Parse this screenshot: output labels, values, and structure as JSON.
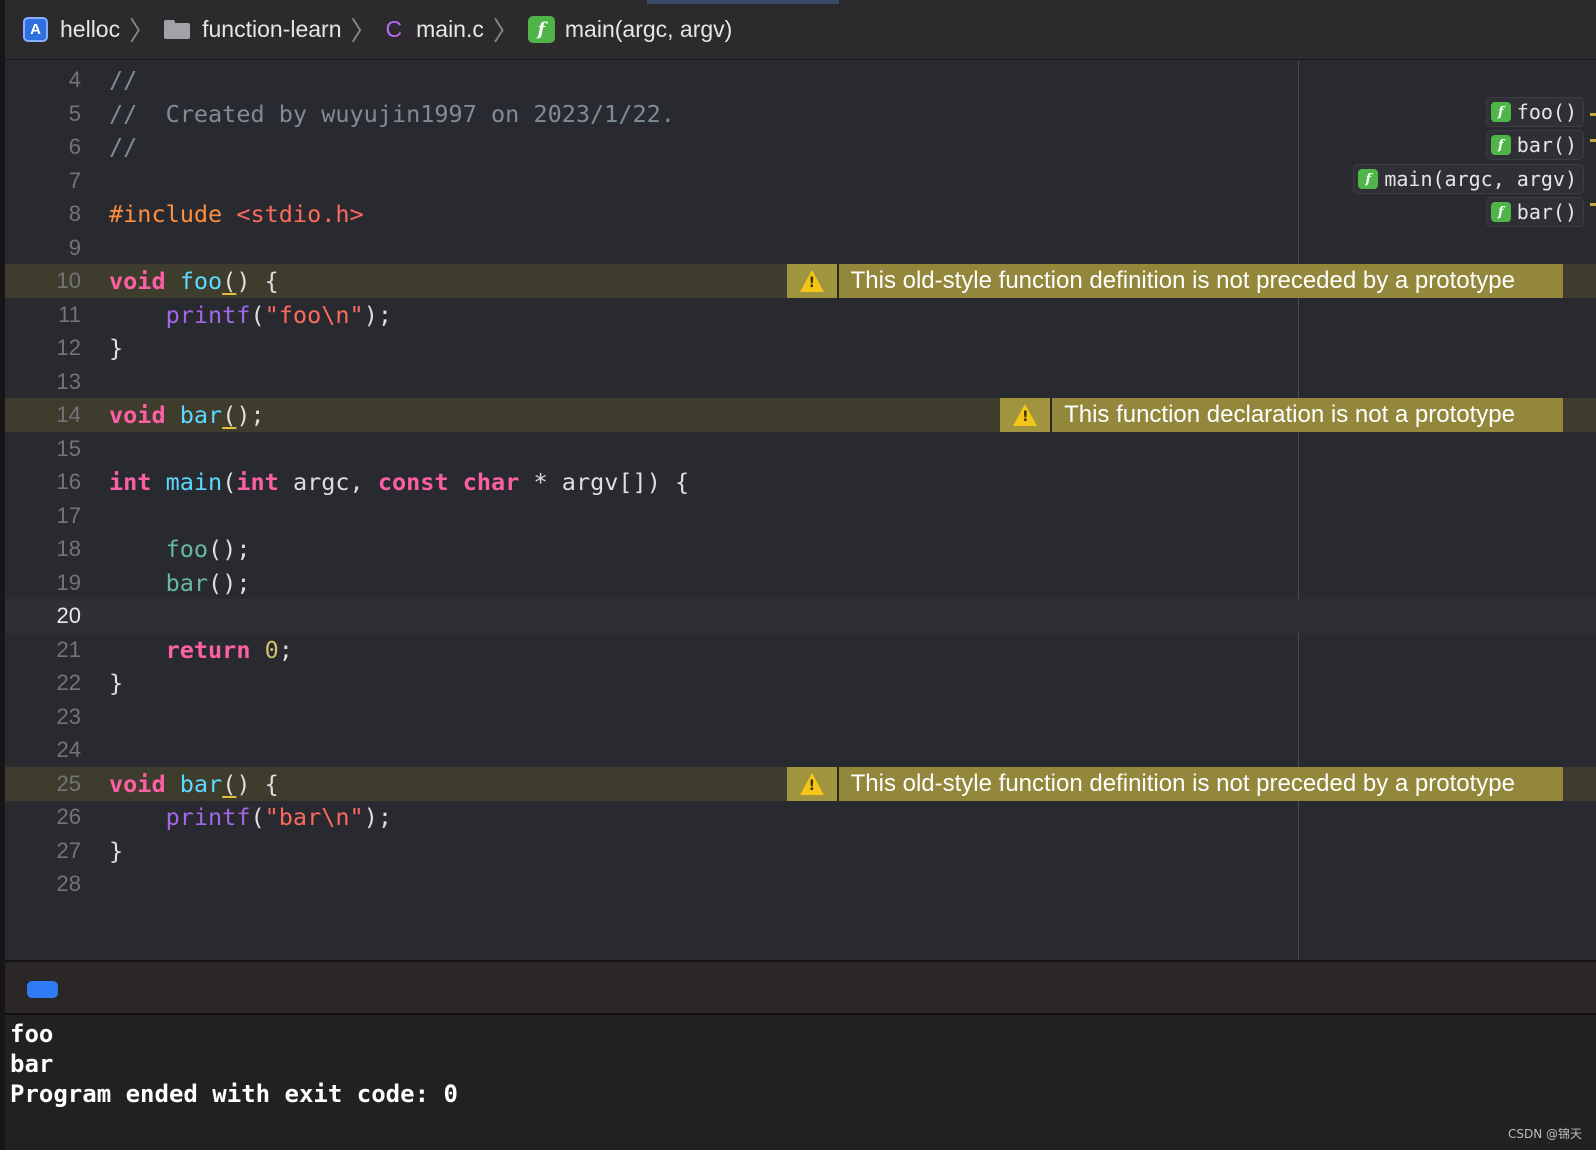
{
  "breadcrumb": {
    "project": "helloc",
    "folder": "function-learn",
    "file_type": "C",
    "file": "main.c",
    "function": "main(argc, argv)"
  },
  "editor": {
    "lines": [
      {
        "n": "4",
        "html": "<span class=\"cmt\">//</span>"
      },
      {
        "n": "5",
        "html": "<span class=\"cmt\">//  Created by wuyujin1997 on 2023/1/22.</span>"
      },
      {
        "n": "6",
        "html": "<span class=\"cmt\">//</span>"
      },
      {
        "n": "7",
        "html": ""
      },
      {
        "n": "8",
        "html": "<span class=\"pp\">#include</span> <span class=\"ppstr\">&lt;stdio.h&gt;</span>"
      },
      {
        "n": "9",
        "html": ""
      },
      {
        "n": "10",
        "html": "<span class=\"kw\">void</span> <span class=\"fndecl\">foo</span><span class=\"u\">(</span>) {"
      },
      {
        "n": "11",
        "html": "    <span class=\"fncall\">printf</span>(<span class=\"str\">\"foo\\n\"</span>);"
      },
      {
        "n": "12",
        "html": "}"
      },
      {
        "n": "13",
        "html": ""
      },
      {
        "n": "14",
        "html": "<span class=\"kw\">void</span> <span class=\"fndecl\">bar</span><span class=\"u\">(</span>);"
      },
      {
        "n": "15",
        "html": ""
      },
      {
        "n": "16",
        "html": "<span class=\"kw\">int</span> <span class=\"fndecl\">main</span>(<span class=\"kw\">int</span> argc, <span class=\"kw\">const</span> <span class=\"kw\">char</span> * argv[]) {"
      },
      {
        "n": "17",
        "html": ""
      },
      {
        "n": "18",
        "html": "    <span class=\"fn-user\">foo</span>();"
      },
      {
        "n": "19",
        "html": "    <span class=\"fn-user\">bar</span>();"
      },
      {
        "n": "20",
        "html": ""
      },
      {
        "n": "21",
        "html": "    <span class=\"kw\">return</span> <span class=\"num\">0</span>;"
      },
      {
        "n": "22",
        "html": "}"
      },
      {
        "n": "23",
        "html": ""
      },
      {
        "n": "24",
        "html": ""
      },
      {
        "n": "25",
        "html": "<span class=\"kw\">void</span> <span class=\"fndecl\">bar</span><span class=\"u\">(</span>) {"
      },
      {
        "n": "26",
        "html": "    <span class=\"fncall\">printf</span>(<span class=\"str\">\"bar\\n\"</span>);"
      },
      {
        "n": "27",
        "html": "}"
      },
      {
        "n": "28",
        "html": ""
      }
    ],
    "warn_lines": [
      "10",
      "14",
      "25"
    ],
    "current_line": "20"
  },
  "warnings": [
    {
      "line": "10",
      "text": "This old-style function definition is not preceded by a prototype"
    },
    {
      "line": "14",
      "text": "This function declaration is not a prototype"
    },
    {
      "line": "25",
      "text": "This old-style function definition is not preceded by a prototype"
    }
  ],
  "minimap_functions": [
    {
      "label": "foo()"
    },
    {
      "label": "bar()"
    },
    {
      "label": "main(argc, argv)"
    },
    {
      "label": "bar()"
    }
  ],
  "console": {
    "lines": [
      "foo",
      "bar",
      "Program ended with exit code: 0"
    ]
  },
  "watermark": "CSDN @锦天",
  "colors": {
    "warning_bg": "#92873a",
    "keyword": "#fc5fa3",
    "string": "#fc6a5d",
    "accent": "#2f7bf5"
  }
}
